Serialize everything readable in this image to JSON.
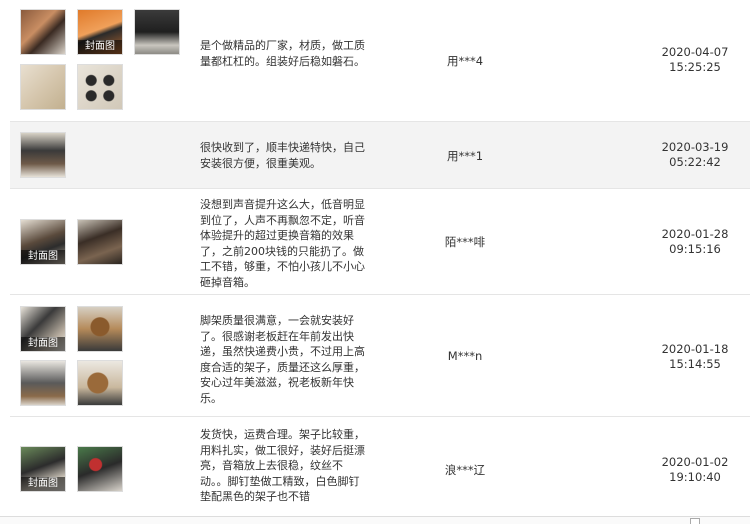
{
  "reviews": [
    {
      "text": "是个做精品的厂家，材质，做工质量都杠杠的。组装好后稳如磐石。",
      "user": "用***4",
      "date": "2020-04-07",
      "time": "15:25:25",
      "cover_label": "封面图"
    },
    {
      "text": "很快收到了，顺丰快递特快，自己安装很方便，很重美观。",
      "user": "用***1",
      "date": "2020-03-19",
      "time": "05:22:42"
    },
    {
      "text": "没想到声音提升这么大，低音明显到位了，人声不再飘忽不定，听音体验提升的超过更换音箱的效果了，之前200块钱的只能扔了。做工不错，够重，不怕小孩儿不小心砸掉音箱。",
      "user": "陌***啡",
      "date": "2020-01-28",
      "time": "09:15:16",
      "cover_label": "封面图"
    },
    {
      "text": "脚架质量很满意，一会就安装好了。很感谢老板赶在年前发出快递，虽然快递费小贵，不过用上高度合适的架子，质量还这么厚重，安心过年美滋滋，祝老板新年快乐。",
      "user": "M***n",
      "date": "2020-01-18",
      "time": "15:14:55",
      "cover_label": "封面图"
    },
    {
      "text": "发货快，运费合理。架子比较重，用料扎实，做工很好，装好后挺漂亮，音箱放上去很稳，纹丝不动。。脚钉垫做工精致，白色脚钉垫配黑色的架子也不错",
      "user": "浪***辽",
      "date": "2020-01-02",
      "time": "19:10:40",
      "cover_label": "封面图"
    }
  ]
}
